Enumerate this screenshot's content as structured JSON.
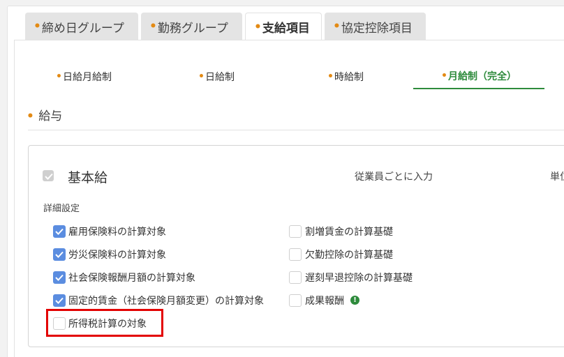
{
  "tabs": [
    {
      "dot": "•",
      "label": "締め日グループ"
    },
    {
      "dot": "•",
      "label": "勤務グループ"
    },
    {
      "dot": "•",
      "label": "支給項目"
    },
    {
      "dot": "•",
      "label": "協定控除項目"
    }
  ],
  "subtabs": [
    {
      "dot": "•",
      "label": "日給月給制"
    },
    {
      "dot": "•",
      "label": "日給制"
    },
    {
      "dot": "•",
      "label": "時給制"
    },
    {
      "dot": "•",
      "label": "月給制（完全）"
    }
  ],
  "section": {
    "dot": "•",
    "title": "給与"
  },
  "item": {
    "title": "基本給",
    "input_mode": "従業員ごとに入力",
    "unit_label": "単位"
  },
  "detail": {
    "heading": "詳細設定",
    "left_options": [
      {
        "label": "雇用保険料の計算対象",
        "checked": true
      },
      {
        "label": "労災保険料の計算対象",
        "checked": true
      },
      {
        "label": "社会保険報酬月額の計算対象",
        "checked": true
      },
      {
        "label": "固定的賃金（社会保険月額変更）の計算対象",
        "checked": true
      },
      {
        "label": "所得税計算の対象",
        "checked": false
      }
    ],
    "right_options": [
      {
        "label": "割増賃金の計算基礎",
        "checked": false
      },
      {
        "label": "欠勤控除の計算基礎",
        "checked": false
      },
      {
        "label": "遅刻早退控除の計算基礎",
        "checked": false
      },
      {
        "label": "成果報酬",
        "checked": false
      }
    ],
    "info_glyph": "!"
  },
  "colors": {
    "accent_orange": "#e38a14",
    "accent_green": "#2e8b3c",
    "checkbox_blue": "#5b8de0",
    "highlight_red": "#e30000"
  }
}
